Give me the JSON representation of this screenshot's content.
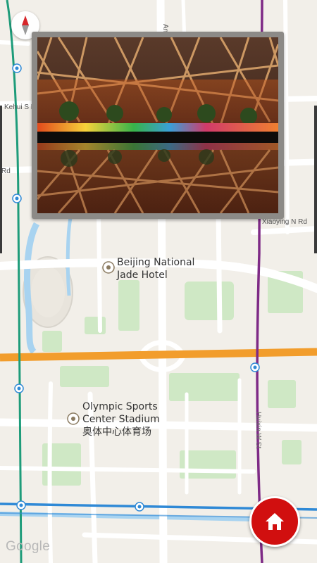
{
  "map": {
    "poi": [
      {
        "name": "Beijing National\nJade Hotel"
      },
      {
        "name": "Olympic Sports\nCenter Stadium\n奥体中心体育场"
      }
    ],
    "streets": {
      "kehui": "Kehui S Rd",
      "xiaoying": "Xiaoying N Rd",
      "rd": "Rd",
      "anli": "Anl",
      "huixin": "Huixin W St"
    },
    "attribution": "Google"
  },
  "photo": {
    "subject": "Beijing National Stadium (Bird's Nest) illuminated at night"
  },
  "controls": {
    "compass_icon": "compass-icon",
    "home_icon": "home-icon",
    "home_color": "#d10f0f"
  },
  "colors": {
    "land": "#f2efe9",
    "road": "#ffffff",
    "highway": "#f29d2c",
    "water": "#a8d3f0",
    "park": "#cfe8c5",
    "metro_green": "#1e9c7a",
    "metro_purple": "#7e2a86",
    "metro_blue": "#2f89d6"
  }
}
